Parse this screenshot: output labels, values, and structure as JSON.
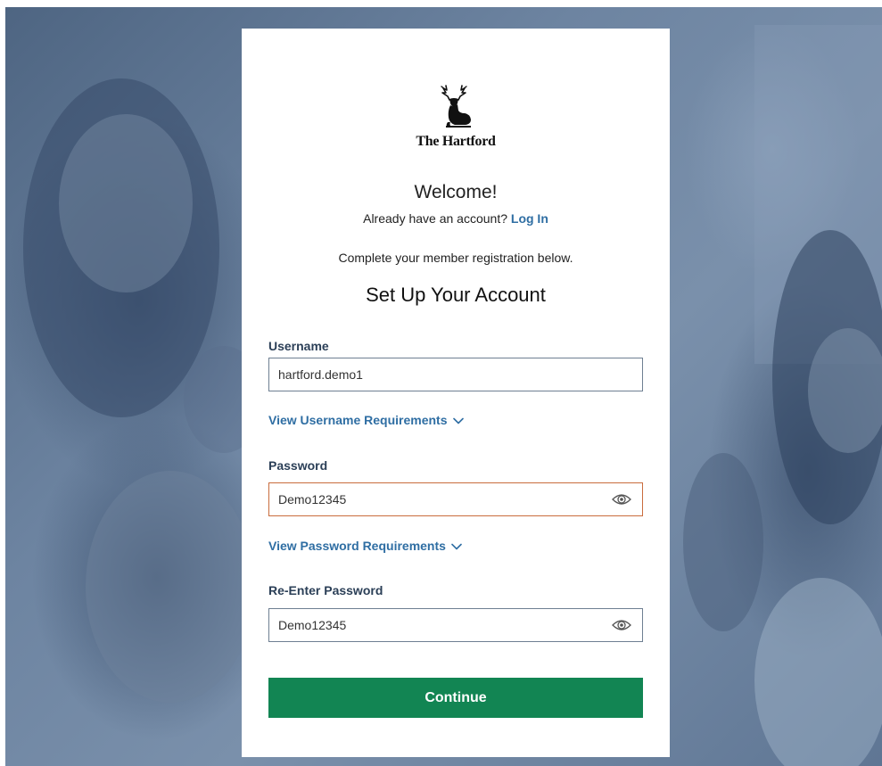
{
  "brand": {
    "logo_text": "The Hartford"
  },
  "intro": {
    "welcome": "Welcome!",
    "already_text": "Already have an account?",
    "login_link": "Log In",
    "complete_text": "Complete your member registration below.",
    "heading": "Set Up Your Account"
  },
  "form": {
    "username": {
      "label": "Username",
      "value": "hartford.demo1",
      "requirements_link": "View Username Requirements"
    },
    "password": {
      "label": "Password",
      "value": "Demo12345",
      "requirements_link": "View Password Requirements"
    },
    "reenter_password": {
      "label": "Re-Enter Password",
      "value": "Demo12345"
    },
    "continue_label": "Continue"
  },
  "icons": {
    "eye": "eye-icon",
    "chevron": "chevron-down-icon",
    "logo": "stag-logo-icon"
  },
  "colors": {
    "link": "#2f6ea3",
    "label": "#2b3f57",
    "button": "#128553",
    "error_border": "#c96c3d",
    "field_border": "#6e7f92"
  }
}
